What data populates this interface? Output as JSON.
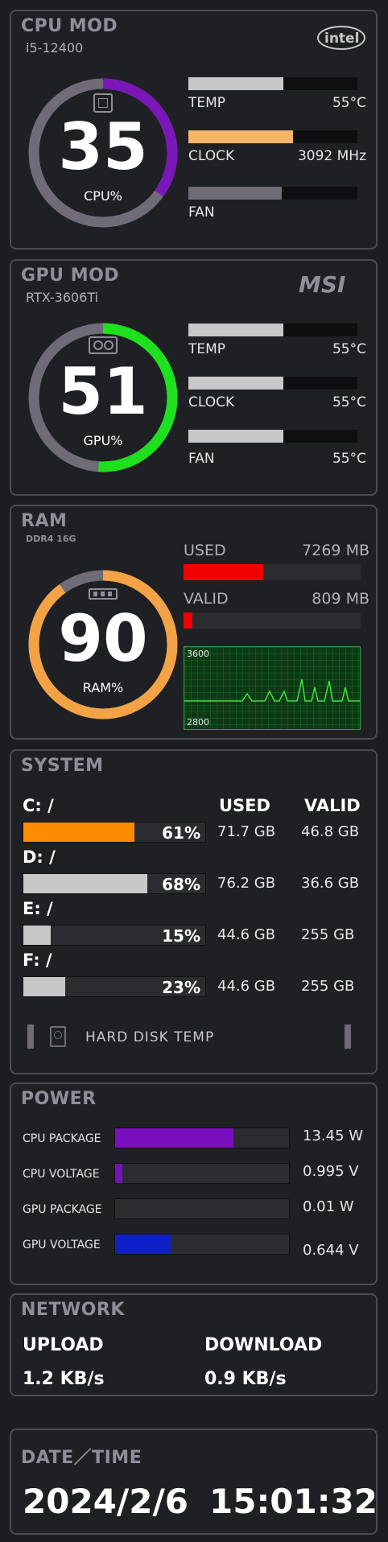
{
  "cpu": {
    "title": "CPU MOD",
    "model": "i5-12400",
    "brand": "intel",
    "value": "35",
    "unit_label": "CPU%",
    "percent": 35,
    "ring_color": "#7a17b8",
    "temp_label": "TEMP",
    "temp_value": "55°C",
    "temp_fill": 0.56,
    "clock_label": "CLOCK",
    "clock_value": "3092 MHz",
    "clock_fill": 0.62,
    "fan_label": "FAN",
    "fan_fill": 0.55
  },
  "gpu": {
    "title": "GPU MOD",
    "model": "RTX-3606Ti",
    "brand": "MSI",
    "value": "51",
    "unit_label": "GPU%",
    "percent": 51,
    "ring_color": "#1ee01e",
    "temp_label": "TEMP",
    "temp_value": "55°C",
    "temp_fill": 0.56,
    "clock_label": "CLOCK",
    "clock_value": "55°C",
    "clock_fill": 0.56,
    "fan_label": "FAN",
    "fan_value": "55°C",
    "fan_fill": 0.56
  },
  "ram": {
    "title": "RAM",
    "model": "DDR4 16G",
    "value": "90",
    "unit_label": "RAM%",
    "percent": 90,
    "ring_color": "#f3a345",
    "used_label": "USED",
    "used_value": "7269 MB",
    "used_fill": 0.45,
    "valid_label": "VALID",
    "valid_value": "809 MB",
    "valid_fill": 0.05,
    "graph_max": "3600",
    "graph_min": "2800"
  },
  "system": {
    "title": "SYSTEM",
    "used_header": "USED",
    "valid_header": "VALID",
    "disks": [
      {
        "label": "C: /",
        "percent": "61%",
        "fill": 0.61,
        "color": "#ff8c00",
        "used": "71.7 GB",
        "valid": "46.8 GB"
      },
      {
        "label": "D: /",
        "percent": "68%",
        "fill": 0.68,
        "color": "#c8c8c8",
        "used": "76.2 GB",
        "valid": "36.6 GB"
      },
      {
        "label": "E: /",
        "percent": "15%",
        "fill": 0.15,
        "color": "#c8c8c8",
        "used": "44.6 GB",
        "valid": "255 GB"
      },
      {
        "label": "F: /",
        "percent": "23%",
        "fill": 0.23,
        "color": "#c8c8c8",
        "used": "44.6 GB",
        "valid": "255 GB"
      }
    ],
    "hdd_temp_label": "HARD DISK TEMP"
  },
  "power": {
    "title": "POWER",
    "rows": [
      {
        "label": "CPU PACKAGE",
        "value": "13.45 W",
        "fill": 0.68,
        "color": "#7a0fc0"
      },
      {
        "label": "CPU VOLTAGE",
        "value": "0.995 V",
        "fill": 0.04,
        "color": "#7a0fc0"
      },
      {
        "label": "GPU PACKAGE",
        "value": "0.01 W",
        "fill": 0.0,
        "color": "#7a0fc0"
      },
      {
        "label": "GPU VOLTAGE",
        "value": "0.644 V",
        "fill": 0.32,
        "color": "#1020c8"
      }
    ]
  },
  "network": {
    "title": "NETWORK",
    "upload_label": "UPLOAD",
    "upload_value": "1.2 KB/s",
    "download_label": "DOWNLOAD",
    "download_value": "0.9 KB/s"
  },
  "datetime": {
    "title": "DATE／TIME",
    "date": "2024/2/6",
    "time": "15:01:32"
  }
}
